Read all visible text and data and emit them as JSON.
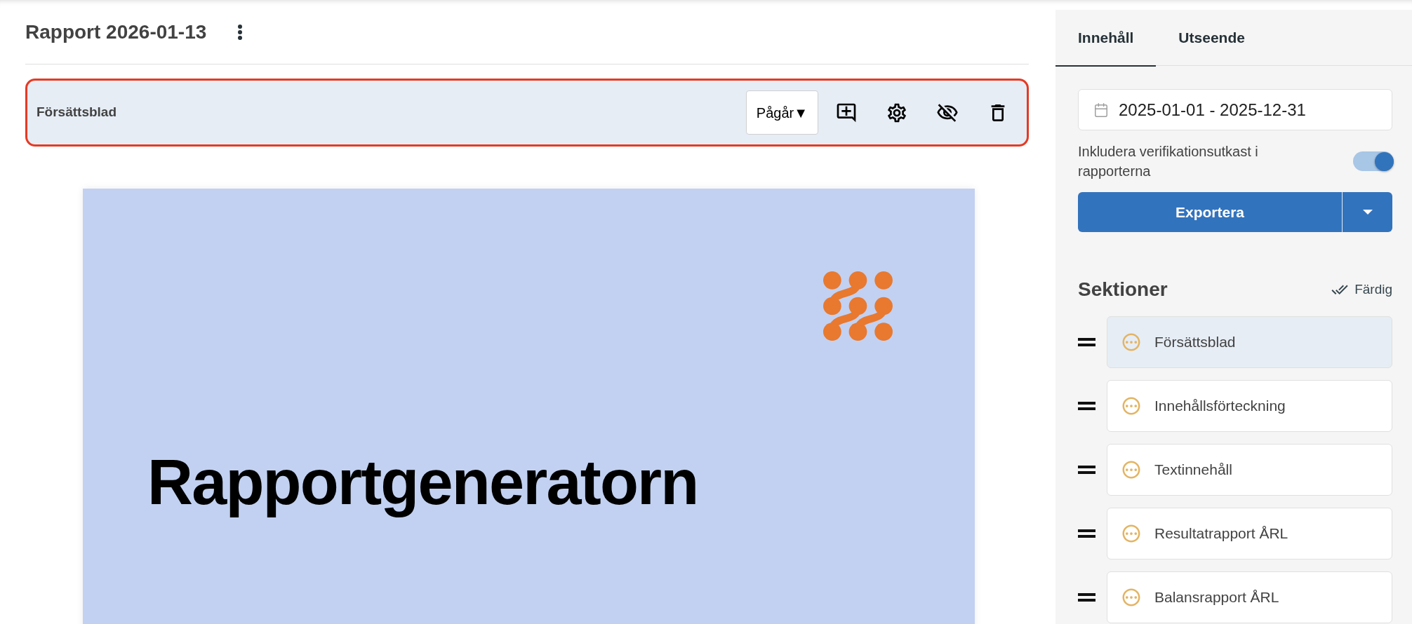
{
  "header": {
    "title": "Rapport 2026-01-13"
  },
  "section_toolbar": {
    "selected": true,
    "title": "Försättsblad",
    "status": "Pågår▼"
  },
  "preview": {
    "title": "Rapportgeneratorn"
  },
  "panel": {
    "tabs": [
      {
        "label": "Innehåll",
        "selected": true
      },
      {
        "label": "Utseende",
        "selected": false
      }
    ],
    "date_range": "2025-01-01 - 2025-12-31",
    "include_drafts": {
      "label": "Inkludera verifikationsutkast i rapporterna",
      "on": true
    },
    "export_label": "Exportera",
    "sections_heading": "Sektioner",
    "done_label": "Färdig",
    "sections": [
      {
        "name": "Försättsblad",
        "selected": true
      },
      {
        "name": "Innehållsförteckning",
        "selected": false
      },
      {
        "name": "Textinnehåll",
        "selected": false
      },
      {
        "name": "Resultatrapport ÅRL",
        "selected": false
      },
      {
        "name": "Balansrapport ÅRL",
        "selected": false
      }
    ]
  }
}
